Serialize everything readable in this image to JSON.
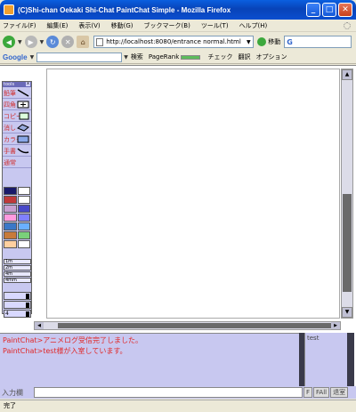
{
  "window": {
    "title": "(C)Shi-chan Oekaki Shi-Chat PaintChat Simple - Mozilla Firefox",
    "minimize": "_",
    "maximize": "□",
    "close": "✕"
  },
  "menu": [
    "ファイル(F)",
    "編集(E)",
    "表示(V)",
    "移動(G)",
    "ブックマーク(B)",
    "ツール(T)",
    "ヘルプ(H)"
  ],
  "nav": {
    "url": "http://localhost:8080/entrance normal.html",
    "go_label": "移動",
    "search_engine": "G"
  },
  "google_toolbar": {
    "logo": "Google",
    "search": "検索",
    "pagerank": "PageRank",
    "check": "チェック",
    "translate": "翻訳",
    "options": "オプション"
  },
  "palette": {
    "header": "tools",
    "tools": [
      "鉛筆",
      "四角",
      "コピー",
      "消し",
      "カラー",
      "手書",
      "通常"
    ],
    "colors": [
      [
        "#1a1a6a",
        "#ffffff"
      ],
      [
        "#c03a3a",
        "#ffffff"
      ],
      [
        "#c8a0d0",
        "#4848c8"
      ],
      [
        "#ff9adf",
        "#8080ff"
      ],
      [
        "#3a78c8",
        "#6ab0ff"
      ],
      [
        "#c87a3a",
        "#7ad07a"
      ],
      [
        "#ffd0a0",
        "#ffffff"
      ]
    ],
    "sizes": [
      "1m",
      "2m",
      "4m",
      "4mm"
    ],
    "blocks": [
      "",
      "",
      "4"
    ]
  },
  "chat": {
    "messages": [
      "PaintChat>アニメログ受信完了しました。",
      "PaintChat>test様が入室しています。"
    ],
    "users": [
      "test"
    ],
    "input_label": "入力欄",
    "input_value": "",
    "buttons": [
      "F",
      "FAll",
      "退室"
    ]
  },
  "status": "完了"
}
